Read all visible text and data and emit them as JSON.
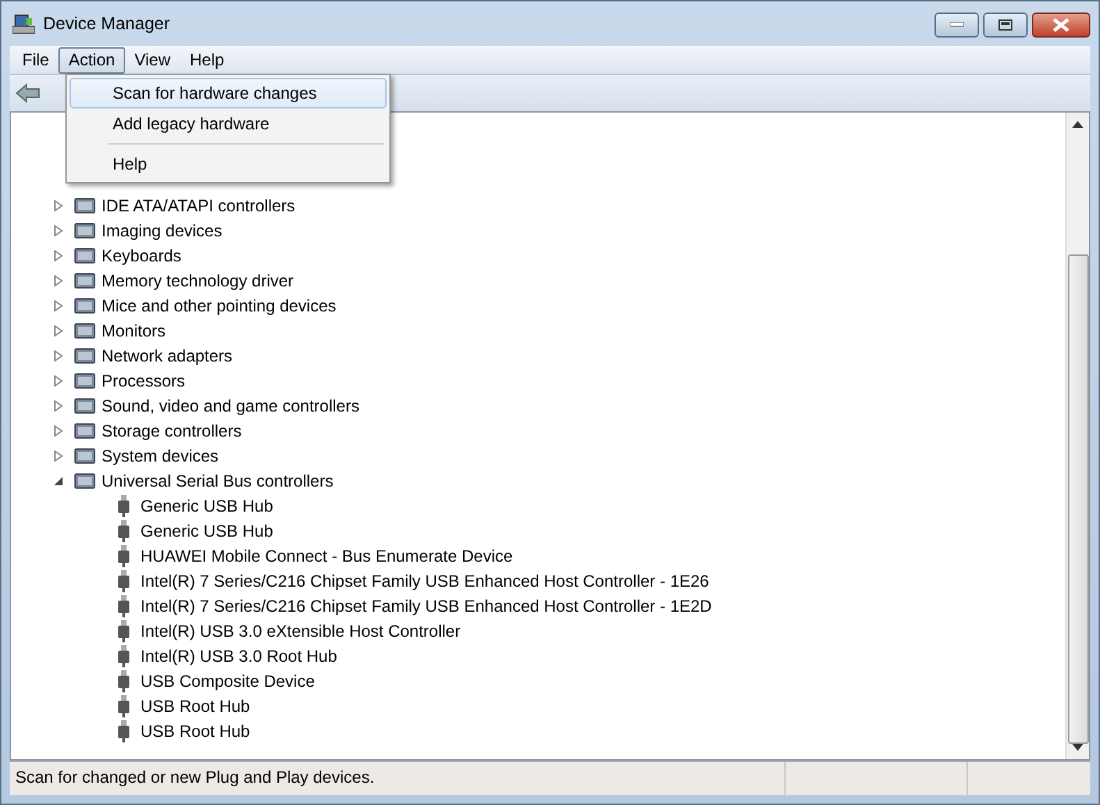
{
  "window": {
    "title": "Device Manager"
  },
  "menu_bar": [
    {
      "label": "File",
      "selected": false
    },
    {
      "label": "Action",
      "selected": true
    },
    {
      "label": "View",
      "selected": false
    },
    {
      "label": "Help",
      "selected": false
    }
  ],
  "action_menu": [
    {
      "label": "Scan for hardware changes",
      "selected": true,
      "kind": "item"
    },
    {
      "label": "Add legacy hardware",
      "selected": false,
      "kind": "item"
    },
    {
      "kind": "separator"
    },
    {
      "label": "Help",
      "selected": false,
      "kind": "item"
    }
  ],
  "tree": [
    {
      "label": "IDE ATA/ATAPI controllers",
      "expanded": false
    },
    {
      "label": "Imaging devices",
      "expanded": false
    },
    {
      "label": "Keyboards",
      "expanded": false
    },
    {
      "label": "Memory technology driver",
      "expanded": false
    },
    {
      "label": "Mice and other pointing devices",
      "expanded": false
    },
    {
      "label": "Monitors",
      "expanded": false
    },
    {
      "label": "Network adapters",
      "expanded": false
    },
    {
      "label": "Processors",
      "expanded": false
    },
    {
      "label": "Sound, video and game controllers",
      "expanded": false
    },
    {
      "label": "Storage controllers",
      "expanded": false
    },
    {
      "label": "System devices",
      "expanded": false
    },
    {
      "label": "Universal Serial Bus controllers",
      "expanded": true,
      "children": [
        {
          "label": "Generic USB Hub"
        },
        {
          "label": "Generic USB Hub"
        },
        {
          "label": "HUAWEI Mobile Connect - Bus Enumerate Device"
        },
        {
          "label": "Intel(R) 7 Series/C216 Chipset Family USB Enhanced Host Controller - 1E26"
        },
        {
          "label": "Intel(R) 7 Series/C216 Chipset Family USB Enhanced Host Controller - 1E2D"
        },
        {
          "label": "Intel(R) USB 3.0 eXtensible Host Controller"
        },
        {
          "label": "Intel(R) USB 3.0 Root Hub"
        },
        {
          "label": "USB Composite Device"
        },
        {
          "label": "USB Root Hub"
        },
        {
          "label": "USB Root Hub"
        }
      ]
    }
  ],
  "status_bar": "Scan for changed or new Plug and Play devices."
}
